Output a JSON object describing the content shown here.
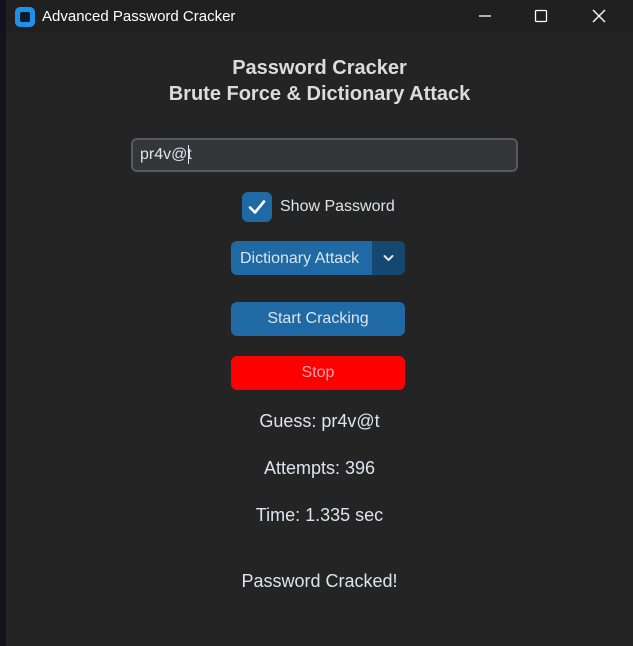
{
  "window": {
    "title": "Advanced Password Cracker",
    "controls": [
      "minimize-icon",
      "maximize-icon",
      "close-icon"
    ]
  },
  "header": {
    "line1": "Password Cracker",
    "line2": "Brute Force & Dictionary Attack"
  },
  "password_input": {
    "value": "pr4v@t"
  },
  "show_password": {
    "label": "Show Password",
    "checked": true
  },
  "attack_mode": {
    "selected": "Dictionary Attack"
  },
  "buttons": {
    "start_label": "Start Cracking",
    "stop_label": "Stop"
  },
  "results": {
    "guess": "Guess: pr4v@t",
    "attempts": "Attempts: 396",
    "time": "Time: 1.335 sec",
    "status": "Password Cracked!"
  },
  "colors": {
    "accent": "#1f6aa5",
    "accent_dark": "#144870",
    "stop": "#ff0000",
    "background": "#242424",
    "text": "#dce4ee"
  }
}
